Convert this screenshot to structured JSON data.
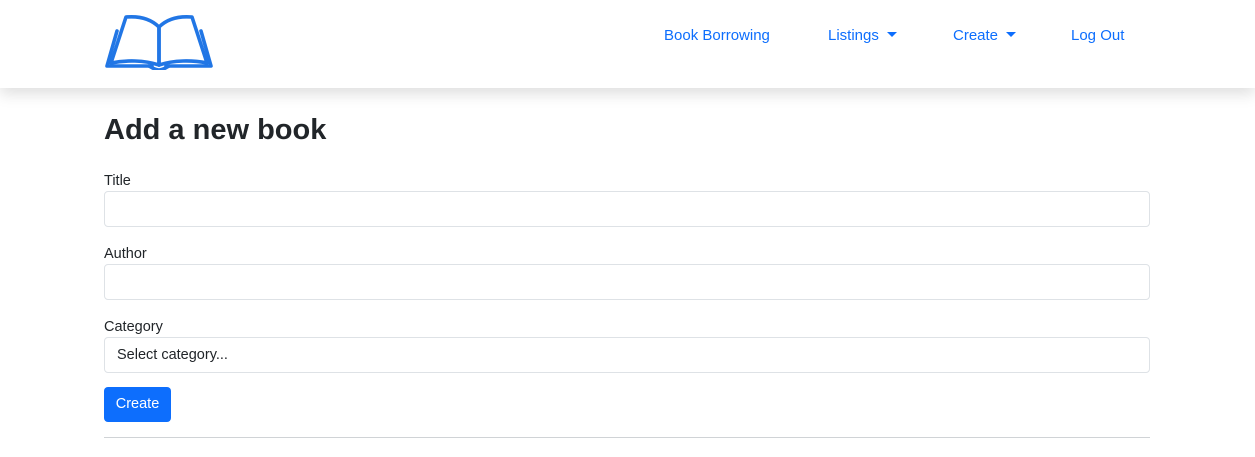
{
  "navbar": {
    "logo_icon": "open-book-icon",
    "links": [
      {
        "label": "Book Borrowing"
      },
      {
        "label": "Listings",
        "dropdown": true
      },
      {
        "label": "Create",
        "dropdown": true
      },
      {
        "label": "Log Out"
      }
    ]
  },
  "page": {
    "title": "Add a new book"
  },
  "form": {
    "title_label": "Title",
    "title_value": "",
    "author_label": "Author",
    "author_value": "",
    "category_label": "Category",
    "category_selected": "Select category...",
    "submit_label": "Create"
  },
  "colors": {
    "accent": "#0d6efd",
    "text": "#212529",
    "border": "#dee2e6"
  }
}
